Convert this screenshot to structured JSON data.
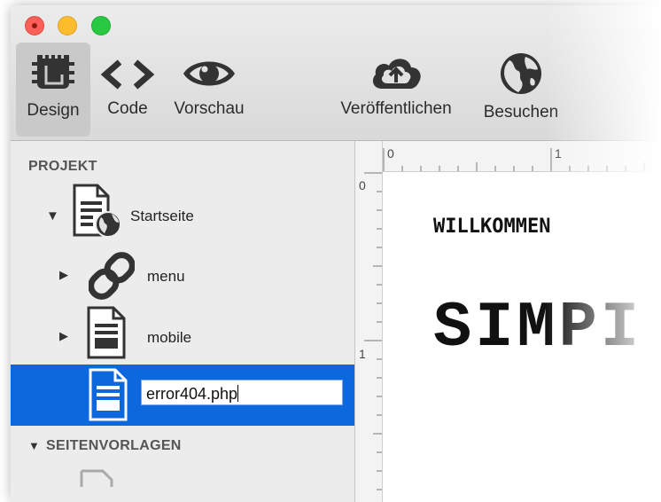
{
  "toolbar": {
    "design_label": "Design",
    "code_label": "Code",
    "preview_label": "Vorschau",
    "publish_label": "Veröffentlichen",
    "visit_label": "Besuchen"
  },
  "sidebar": {
    "section_project": "PROJEKT",
    "items": [
      {
        "label": "Startseite"
      },
      {
        "label": "menu"
      },
      {
        "label": "mobile"
      }
    ],
    "rename_value": "error404.php",
    "section_templates": "SEITENVORLAGEN"
  },
  "rulers": {
    "top": [
      "0",
      "1"
    ],
    "left": [
      "0",
      "1"
    ]
  },
  "canvas": {
    "heading": "WILLKOMMEN",
    "title": "SIMPI"
  },
  "colors": {
    "selection": "#0d67dd",
    "close": "#fc5f57",
    "minimize": "#fdbc2e",
    "maximize": "#28c840"
  },
  "icons": {
    "design": "chip-icon",
    "code": "code-brackets-icon",
    "preview": "eye-icon",
    "publish": "cloud-upload-icon",
    "visit": "globe-icon"
  }
}
